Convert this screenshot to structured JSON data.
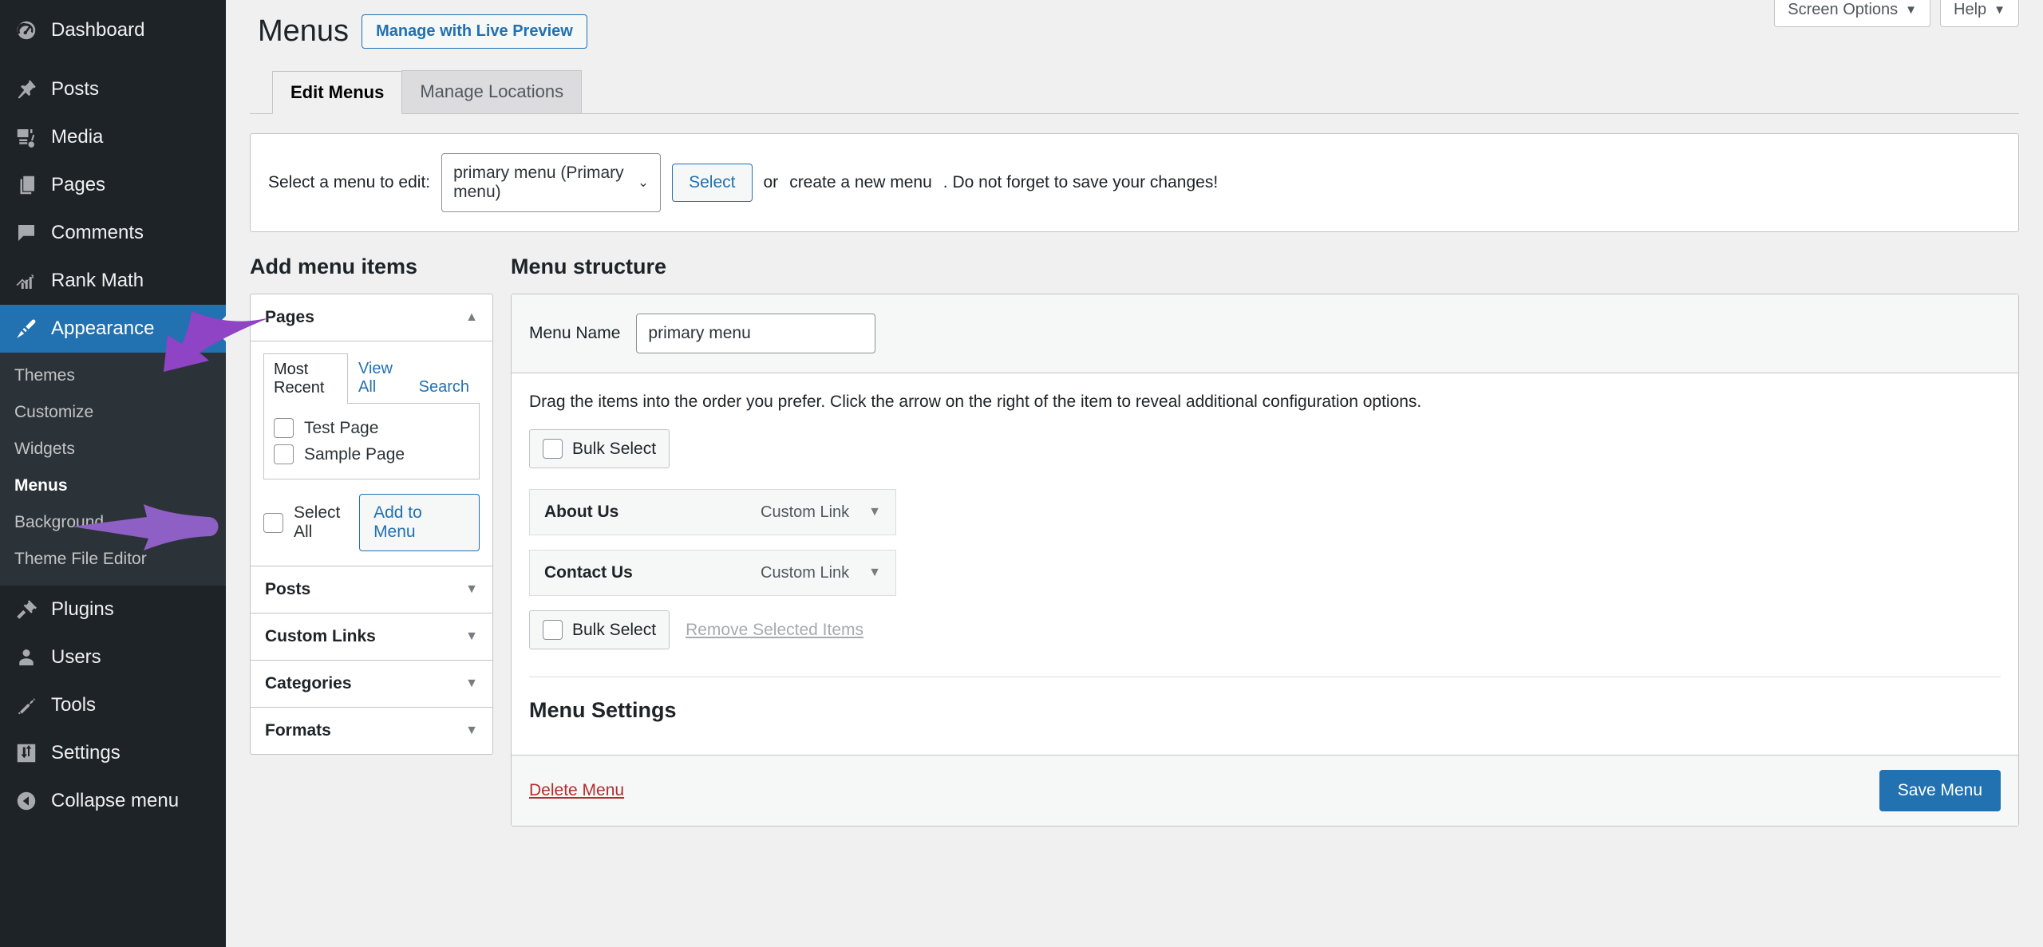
{
  "sidebar": {
    "items": [
      {
        "label": "Dashboard",
        "icon": "dashboard-icon"
      },
      {
        "label": "Posts",
        "icon": "pin-icon"
      },
      {
        "label": "Media",
        "icon": "media-icon"
      },
      {
        "label": "Pages",
        "icon": "pages-icon"
      },
      {
        "label": "Comments",
        "icon": "comment-icon"
      },
      {
        "label": "Rank Math",
        "icon": "rank-math-icon"
      },
      {
        "label": "Appearance",
        "icon": "brush-icon"
      },
      {
        "label": "Plugins",
        "icon": "plug-icon"
      },
      {
        "label": "Users",
        "icon": "user-icon"
      },
      {
        "label": "Tools",
        "icon": "wrench-icon"
      },
      {
        "label": "Settings",
        "icon": "sliders-icon"
      },
      {
        "label": "Collapse menu",
        "icon": "collapse-icon"
      }
    ],
    "appearance_submenu": [
      {
        "label": "Themes"
      },
      {
        "label": "Customize"
      },
      {
        "label": "Widgets"
      },
      {
        "label": "Menus"
      },
      {
        "label": "Background"
      },
      {
        "label": "Theme File Editor"
      }
    ],
    "active_item": "Appearance",
    "current_subitem": "Menus"
  },
  "header": {
    "screen_options_label": "Screen Options",
    "help_label": "Help",
    "caret": "▼",
    "page_title": "Menus",
    "live_preview_label": "Manage with Live Preview"
  },
  "tabs": [
    {
      "label": "Edit Menus",
      "active": true
    },
    {
      "label": "Manage Locations",
      "active": false
    }
  ],
  "select_bar": {
    "label": "Select a menu to edit:",
    "selected_menu": "primary menu (Primary menu)",
    "chevron": "⌄",
    "select_button": "Select",
    "or_text": "or",
    "create_link": "create a new menu",
    "trailing_text": ". Do not forget to save your changes!"
  },
  "add_menu_items": {
    "title": "Add menu items",
    "pages_panel": {
      "heading": "Pages",
      "toggle_icon": "▲",
      "tabs": [
        {
          "label": "Most Recent",
          "active": true
        },
        {
          "label": "View All",
          "active": false
        },
        {
          "label": "Search",
          "active": false
        }
      ],
      "pages": [
        {
          "label": "Test Page",
          "checked": false
        },
        {
          "label": "Sample Page",
          "checked": false
        }
      ],
      "select_all_label": "Select All",
      "add_to_menu_label": "Add to Menu"
    },
    "collapsed_panels": [
      {
        "heading": "Posts",
        "toggle_icon": "▼"
      },
      {
        "heading": "Custom Links",
        "toggle_icon": "▼"
      },
      {
        "heading": "Categories",
        "toggle_icon": "▼"
      },
      {
        "heading": "Formats",
        "toggle_icon": "▼"
      }
    ]
  },
  "menu_structure": {
    "title": "Menu structure",
    "menu_name_label": "Menu Name",
    "menu_name_value": "primary menu",
    "hint": "Drag the items into the order you prefer. Click the arrow on the right of the item to reveal additional configuration options.",
    "bulk_select_label": "Bulk Select",
    "items": [
      {
        "title": "About Us",
        "type": "Custom Link",
        "toggle_icon": "▼"
      },
      {
        "title": "Contact Us",
        "type": "Custom Link",
        "toggle_icon": "▼"
      }
    ],
    "bulk_select_bottom_label": "Bulk Select",
    "remove_selected_label": "Remove Selected Items",
    "settings_title": "Menu Settings",
    "delete_menu_label": "Delete Menu",
    "save_menu_label": "Save Menu"
  },
  "annotations": [
    {
      "name": "arrow-to-appearance",
      "color": "#8e44c4"
    },
    {
      "name": "arrow-to-menus",
      "color": "#8e5fc4"
    }
  ],
  "colors": {
    "sidebar_bg": "#1d2327",
    "submenu_bg": "#2c3338",
    "accent_blue": "#2271b1",
    "page_bg": "#f0f0f1",
    "delete_red": "#b32d2e",
    "annotation_purple": "#8e44c4"
  }
}
